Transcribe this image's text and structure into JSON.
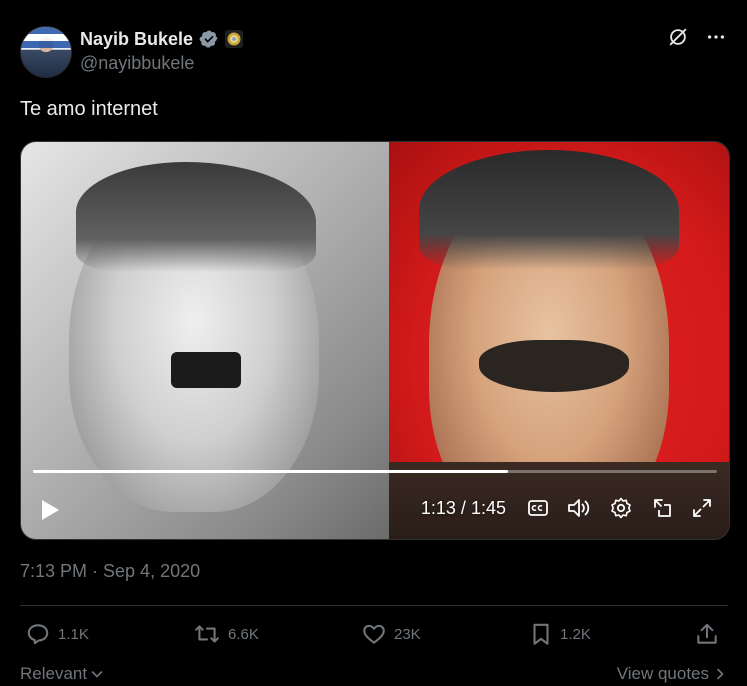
{
  "author": {
    "name": "Nayib Bukele",
    "handle": "@nayibbukele"
  },
  "tweet": {
    "text": "Te amo internet",
    "timestamp": "7:13 PM · Sep 4, 2020"
  },
  "video": {
    "current_time": "1:13",
    "separator": "/",
    "duration": "1:45",
    "progress": 0.695
  },
  "stats": {
    "replies": "1.1K",
    "reposts": "6.6K",
    "likes": "23K",
    "bookmarks": "1.2K"
  },
  "footer": {
    "sort_label": "Relevant",
    "view_quotes_label": "View quotes"
  },
  "colors": {
    "background": "#000000",
    "text_primary": "#e7e9ea",
    "text_secondary": "#71767b",
    "verified_blue": "#8b98a5",
    "divider": "#2f3336"
  },
  "icons": [
    "verified-badge-icon",
    "government-badge-icon",
    "grok-icon",
    "more-icon",
    "play-icon",
    "captions-icon",
    "volume-icon",
    "settings-icon",
    "pop-out-icon",
    "fullscreen-icon",
    "reply-icon",
    "repost-icon",
    "like-icon",
    "bookmark-icon",
    "share-icon",
    "chevron-down-icon",
    "chevron-right-icon"
  ]
}
